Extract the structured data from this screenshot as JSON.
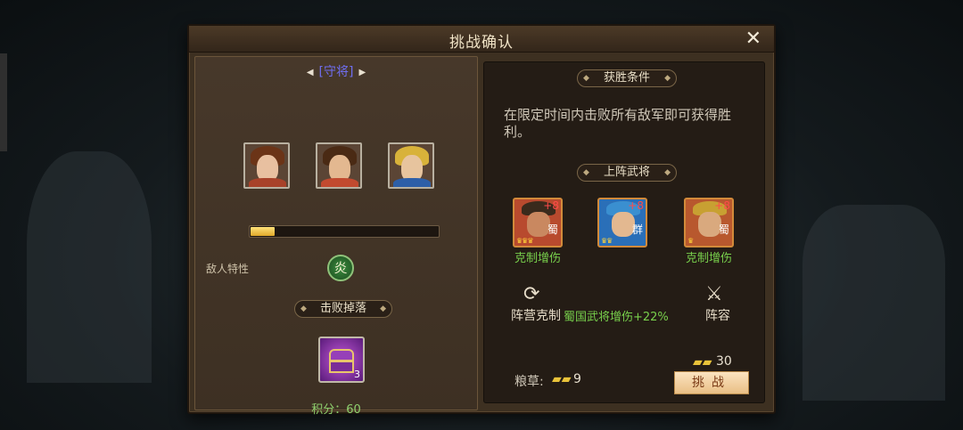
{
  "dialog": {
    "title": "挑战确认",
    "close_label": "✕"
  },
  "left": {
    "defender_label": "[守将]",
    "defenders": [
      {
        "hair": "#6b3417",
        "body": "#a8422a",
        "face": "#e8c0a0"
      },
      {
        "hair": "#4a2a14",
        "body": "#c24a2f",
        "face": "#e3b890"
      },
      {
        "hair": "#d8b23a",
        "body": "#2d5fa8",
        "face": "#e7c49e"
      }
    ],
    "progress_fraction": 0.13,
    "enemy_trait_label": "敌人特性",
    "trait_icon_char": "炎",
    "drops_title": "击败掉落",
    "chest_count": "3",
    "points_text": "积分：60"
  },
  "right": {
    "victory_title": "获胜条件",
    "victory_desc": "在限定时间内击败所有敌军即可获得胜利。",
    "generals_title": "上阵武将",
    "generals": [
      {
        "plus": "+8",
        "faction": "蜀",
        "crowns": "♛♛♛",
        "label": "克制增伤",
        "bg": "#b84a2e",
        "hat": "#3a2a1c",
        "face": "#c98860"
      },
      {
        "plus": "+8",
        "faction": "群",
        "crowns": "♛♛",
        "label": "",
        "bg": "#2a6fb8",
        "hat": "#3a8fd0",
        "face": "#e3b890"
      },
      {
        "plus": "+8",
        "faction": "蜀",
        "crowns": "♛",
        "label": "克制增伤",
        "bg": "#b8582e",
        "hat": "#c8a032",
        "face": "#d9a97e"
      }
    ],
    "faction_counter_label": "阵营克制",
    "faction_bonus": "蜀国武将增伤+22%",
    "lineup_label": "阵容",
    "grain_label": "粮草:",
    "grain_value": "9",
    "cost_value": "30",
    "challenge_label": "挑战"
  },
  "colors": {
    "accent_green": "#78d04c",
    "defender_purple": "#6f6ef0",
    "button_bg": "#f3cf9a"
  }
}
